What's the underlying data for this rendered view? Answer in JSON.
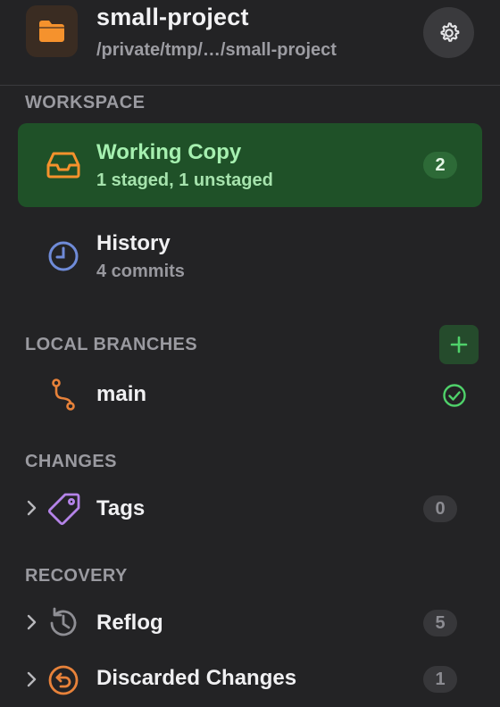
{
  "header": {
    "title": "small-project",
    "path": "/private/tmp/…/small-project",
    "project_icon": "folder-icon",
    "settings_icon": "gear-icon"
  },
  "workspace": {
    "label": "WORKSPACE",
    "items": [
      {
        "title": "Working Copy",
        "subtitle": "1 staged, 1 unstaged",
        "badge": "2",
        "icon": "inbox-icon",
        "active": true
      },
      {
        "title": "History",
        "subtitle": "4 commits",
        "icon": "clock-icon",
        "active": false
      }
    ]
  },
  "local_branches": {
    "label": "LOCAL BRANCHES",
    "add_icon": "plus-icon",
    "items": [
      {
        "title": "main",
        "icon": "branch-icon",
        "status_icon": "check-circle-icon"
      }
    ]
  },
  "changes": {
    "label": "CHANGES",
    "items": [
      {
        "title": "Tags",
        "badge": "0",
        "icon": "tag-icon"
      }
    ]
  },
  "recovery": {
    "label": "RECOVERY",
    "items": [
      {
        "title": "Reflog",
        "badge": "5",
        "icon": "history-icon"
      },
      {
        "title": "Discarded Changes",
        "badge": "1",
        "icon": "undo-circle-icon"
      }
    ]
  },
  "colors": {
    "accent_green": "#1f5128",
    "accent_orange": "#f5922d",
    "text_muted": "#9a9aa0"
  }
}
